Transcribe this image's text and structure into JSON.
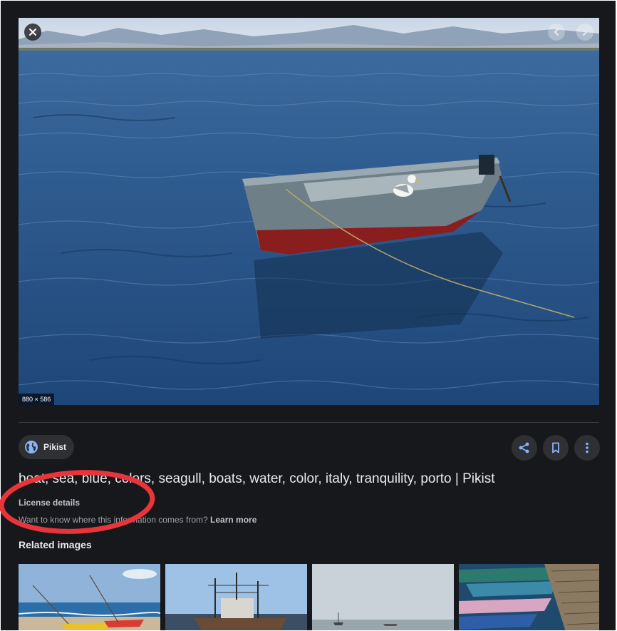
{
  "viewer": {
    "image_dimensions": "880 × 586",
    "close_icon": "close-icon",
    "prev_icon": "chevron-left-icon",
    "next_icon": "chevron-right-icon"
  },
  "source": {
    "name": "Pikist",
    "icon": "globe-icon"
  },
  "actions": {
    "share_icon": "share-icon",
    "save_icon": "bookmark-icon",
    "more_icon": "more-vert-icon"
  },
  "details": {
    "title": "boat, sea, blue, colors, seagull, boats, water, color, italy, tranquility, porto | Pikist",
    "license_label": "License details",
    "info_text": "Want to know where this information comes from?",
    "learn_more": "Learn more"
  },
  "related": {
    "heading": "Related images",
    "count_visible": 4
  },
  "annotation": {
    "shape": "ellipse",
    "color": "#e8343b"
  },
  "colors": {
    "background": "#17181c",
    "chip": "#2f3034",
    "accent_blue": "#8ab4f8",
    "text_primary": "#e8eaed",
    "text_secondary": "#9aa0a6"
  }
}
